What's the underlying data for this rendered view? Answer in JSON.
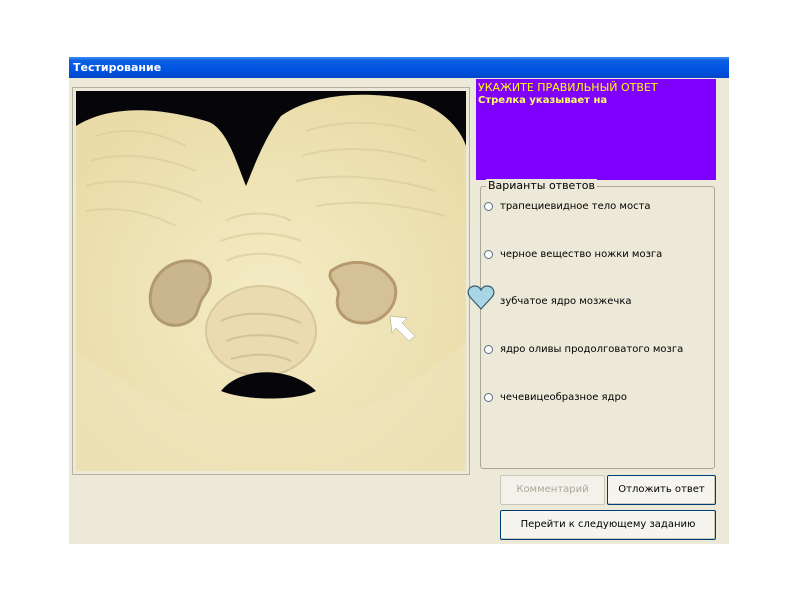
{
  "window": {
    "title": "Тестирование"
  },
  "image": {
    "arrow_icon": "arrow-pointer-icon"
  },
  "question": {
    "title": "УКАЖИТЕ ПРАВИЛЬНЫЙ ОТВЕТ",
    "subtitle": "Стрелка указывает на",
    "box_color": "#8000ff",
    "title_color": "#ffff00"
  },
  "answers": {
    "legend": "Варианты ответов",
    "options": [
      {
        "label": "трапециевидное тело моста"
      },
      {
        "label": "черное вещество ножки мозга"
      },
      {
        "label": "зубчатое ядро мозжечка",
        "marker": "heart-icon"
      },
      {
        "label": "ядро оливы продолговатого мозга"
      },
      {
        "label": "чечевицеобразное ядро"
      }
    ]
  },
  "buttons": {
    "comment": "Комментарий",
    "postpone": "Отложить ответ",
    "next": "Перейти к следующему заданию"
  }
}
